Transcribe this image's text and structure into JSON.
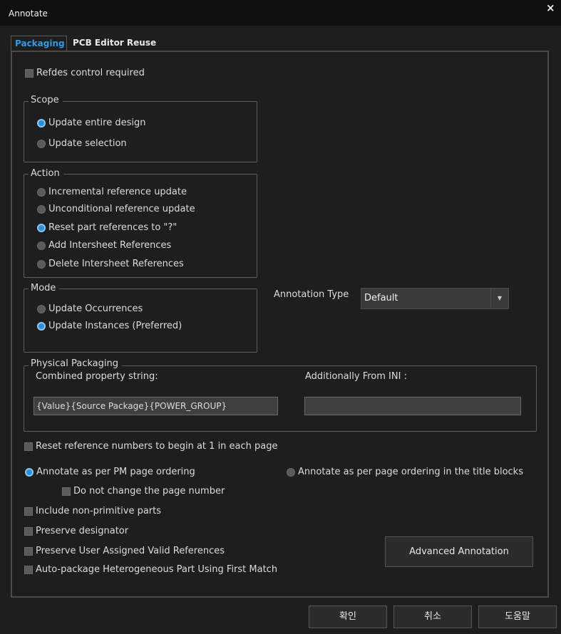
{
  "window": {
    "title": "Annotate",
    "close_glyph": "×"
  },
  "tabs": [
    {
      "label": "Packaging"
    },
    {
      "label": "PCB Editor Reuse"
    }
  ],
  "refdes_control": {
    "label": "Refdes control required"
  },
  "scope": {
    "legend": "Scope",
    "options": [
      {
        "label": "Update entire design",
        "selected": true
      },
      {
        "label": "Update selection",
        "selected": false
      }
    ]
  },
  "action": {
    "legend": "Action",
    "options": [
      {
        "label": "Incremental reference update",
        "selected": false
      },
      {
        "label": "Unconditional reference update",
        "selected": false
      },
      {
        "label": "Reset part references to \"?\"",
        "selected": true
      },
      {
        "label": "Add Intersheet References",
        "selected": false
      },
      {
        "label": "Delete Intersheet References",
        "selected": false
      }
    ]
  },
  "mode": {
    "legend": "Mode",
    "options": [
      {
        "label": "Update Occurrences",
        "selected": false
      },
      {
        "label": "Update Instances (Preferred)",
        "selected": true
      }
    ]
  },
  "annotation_type": {
    "label": "Annotation Type",
    "value": "Default"
  },
  "physical_packaging": {
    "legend": "Physical Packaging",
    "combined_label": "Combined property string:",
    "combined_value": "{Value}{Source Package}{POWER_GROUP}",
    "ini_label": "Additionally From INI :",
    "ini_value": ""
  },
  "options": {
    "reset_numbers": "Reset reference numbers to begin at 1 in each page",
    "pm_ordering": "Annotate as per PM page ordering",
    "title_block_ordering": "Annotate as per page ordering in the title blocks",
    "no_change_page": "Do not change the page number",
    "include_non_primitive": "Include non-primitive parts",
    "preserve_designator": "Preserve designator",
    "preserve_user_refs": "Preserve User Assigned Valid References",
    "auto_package": "Auto-package Heterogeneous Part Using First Match",
    "advanced_button": "Advanced Annotation"
  },
  "footer": {
    "ok": "확인",
    "cancel": "취소",
    "help": "도움말"
  },
  "colors": {
    "accent": "#2c8fdb",
    "background": "#1e1e1e",
    "titlebar": "#0f0f0f"
  }
}
